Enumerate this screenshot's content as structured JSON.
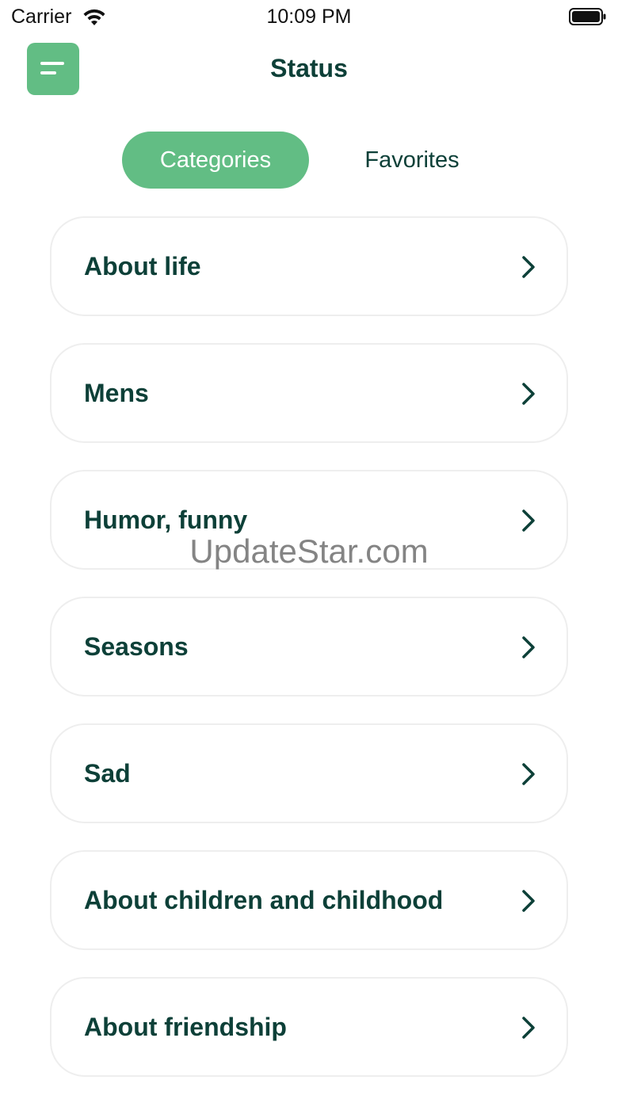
{
  "status_bar": {
    "carrier": "Carrier",
    "time": "10:09 PM",
    "wifi_icon": "wifi-icon",
    "battery_icon": "battery-full-icon"
  },
  "header": {
    "title": "Status",
    "menu_icon": "menu-icon"
  },
  "tabs": [
    {
      "label": "Categories",
      "active": true
    },
    {
      "label": "Favorites",
      "active": false
    }
  ],
  "categories": [
    {
      "label": "About life"
    },
    {
      "label": "Mens"
    },
    {
      "label": "Humor, funny"
    },
    {
      "label": "Seasons"
    },
    {
      "label": "Sad"
    },
    {
      "label": "About children and childhood"
    },
    {
      "label": "About friendship"
    }
  ],
  "watermark": "UpdateStar.com",
  "colors": {
    "accent": "#62bd84",
    "text_dark": "#0d4038",
    "card_border": "#eeeeee"
  }
}
